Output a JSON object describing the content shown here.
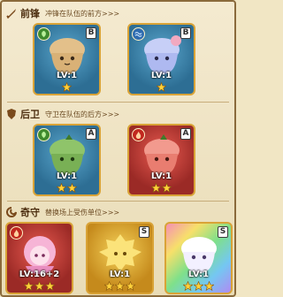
{
  "sections": [
    {
      "title": "前锋",
      "desc": "冲锋在队伍的前方>>>",
      "icon": "sword-icon"
    },
    {
      "title": "后卫",
      "desc": "守卫在队伍的后方>>>",
      "icon": "shield-icon"
    },
    {
      "title": "奇守",
      "desc": "替换场上受伤单位>>>",
      "icon": "swirl-icon"
    }
  ],
  "cards": [
    {
      "rank": "B",
      "element": "grass",
      "level": "LV:1",
      "stars": 1,
      "color": "#2d6e94"
    },
    {
      "rank": "B",
      "element": "water",
      "level": "LV:1",
      "stars": 1,
      "color": "#2d6e94"
    },
    {
      "rank": "A",
      "element": "grass",
      "level": "LV:1",
      "stars": 2,
      "color": "#2d6e94"
    },
    {
      "rank": "A",
      "element": "fire",
      "level": "LV:1",
      "stars": 2,
      "color": "#9b2a26"
    },
    {
      "rank": "",
      "element": "fire",
      "level": "LV:16+2",
      "stars": 3,
      "color": "#9b2a26"
    },
    {
      "rank": "S",
      "element": "",
      "level": "LV:1",
      "stars": 3,
      "color": "#c58a1c"
    },
    {
      "rank": "S",
      "element": "",
      "level": "LV:1",
      "stars": 3,
      "color": "#b08bf2"
    }
  ]
}
